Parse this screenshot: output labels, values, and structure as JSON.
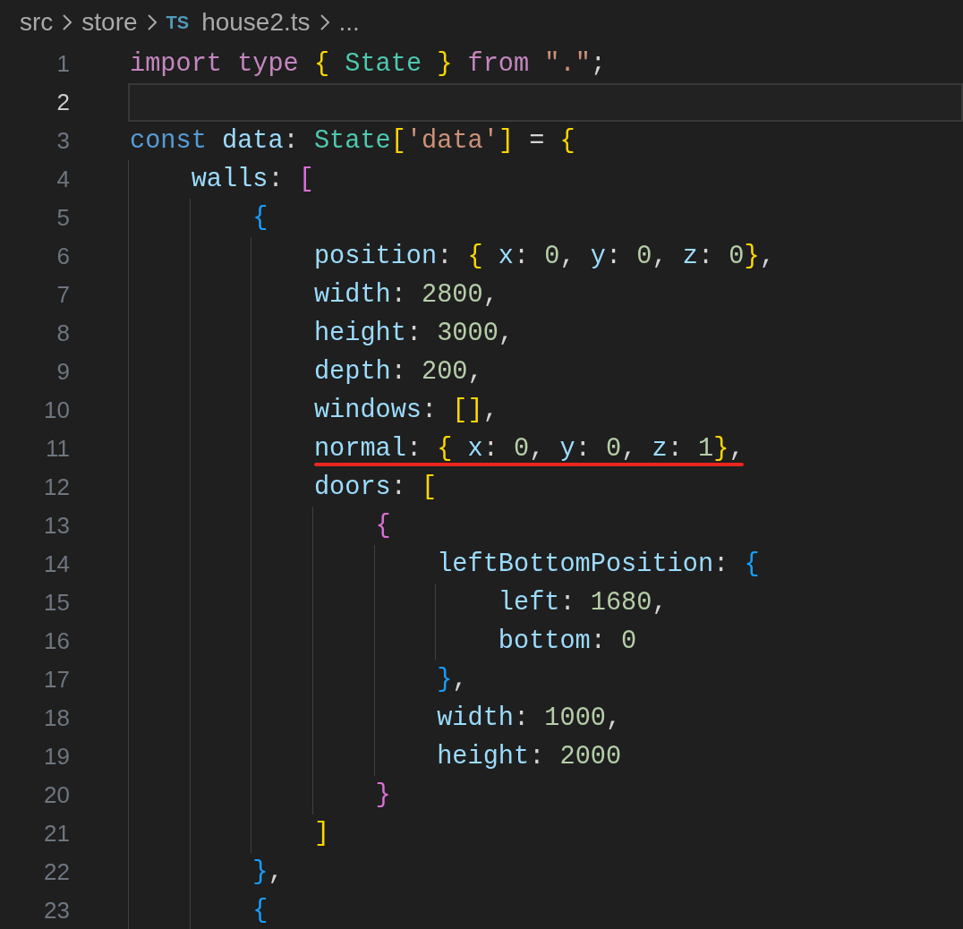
{
  "breadcrumb": [
    {
      "label": "src"
    },
    {
      "label": "store"
    },
    {
      "label": "house2.ts",
      "badge": "TS"
    },
    {
      "label": "..."
    }
  ],
  "editor": {
    "lines": [
      {
        "number": "1",
        "current": false,
        "underlined": false,
        "tokens": [
          {
            "kind": "keyword",
            "text": "import "
          },
          {
            "kind": "keyword",
            "text": "type "
          },
          {
            "kind": "bracket1",
            "text": "{ "
          },
          {
            "kind": "type",
            "text": "State "
          },
          {
            "kind": "bracket1",
            "text": "} "
          },
          {
            "kind": "keyword",
            "text": "from "
          },
          {
            "kind": "string",
            "text": "\".\""
          },
          {
            "kind": "punctuation",
            "text": ";"
          }
        ]
      },
      {
        "number": "2",
        "current": true
      },
      {
        "number": "3",
        "current": false,
        "underlined": false,
        "tokens": [
          {
            "kind": "storage",
            "text": "const "
          },
          {
            "kind": "variable",
            "text": "data"
          },
          {
            "kind": "punctuation",
            "text": ": "
          },
          {
            "kind": "type",
            "text": "State"
          },
          {
            "kind": "bracket1",
            "text": "["
          },
          {
            "kind": "string",
            "text": "'data'"
          },
          {
            "kind": "bracket1",
            "text": "]"
          },
          {
            "kind": "punctuation",
            "text": " = "
          },
          {
            "kind": "bracket1",
            "text": "{"
          }
        ]
      },
      {
        "number": "4",
        "current": false,
        "underlined": false,
        "tokens": [
          {
            "kind": "property",
            "text": "    walls"
          },
          {
            "kind": "punctuation",
            "text": ": "
          },
          {
            "kind": "bracket2",
            "text": "["
          }
        ]
      },
      {
        "number": "5",
        "current": false,
        "underlined": false,
        "tokens": [
          {
            "kind": "bracket3",
            "text": "        {"
          }
        ]
      },
      {
        "number": "6",
        "current": false,
        "underlined": false,
        "tokens": [
          {
            "kind": "property",
            "text": "            position"
          },
          {
            "kind": "punctuation",
            "text": ": "
          },
          {
            "kind": "bracket1",
            "text": "{ "
          },
          {
            "kind": "property",
            "text": "x"
          },
          {
            "kind": "punctuation",
            "text": ": "
          },
          {
            "kind": "number",
            "text": "0"
          },
          {
            "kind": "punctuation",
            "text": ", "
          },
          {
            "kind": "property",
            "text": "y"
          },
          {
            "kind": "punctuation",
            "text": ": "
          },
          {
            "kind": "number",
            "text": "0"
          },
          {
            "kind": "punctuation",
            "text": ", "
          },
          {
            "kind": "property",
            "text": "z"
          },
          {
            "kind": "punctuation",
            "text": ": "
          },
          {
            "kind": "number",
            "text": "0"
          },
          {
            "kind": "bracket1",
            "text": "}"
          },
          {
            "kind": "punctuation",
            "text": ","
          }
        ]
      },
      {
        "number": "7",
        "current": false,
        "underlined": false,
        "tokens": [
          {
            "kind": "property",
            "text": "            width"
          },
          {
            "kind": "punctuation",
            "text": ": "
          },
          {
            "kind": "number",
            "text": "2800"
          },
          {
            "kind": "punctuation",
            "text": ","
          }
        ]
      },
      {
        "number": "8",
        "current": false,
        "underlined": false,
        "tokens": [
          {
            "kind": "property",
            "text": "            height"
          },
          {
            "kind": "punctuation",
            "text": ": "
          },
          {
            "kind": "number",
            "text": "3000"
          },
          {
            "kind": "punctuation",
            "text": ","
          }
        ]
      },
      {
        "number": "9",
        "current": false,
        "underlined": false,
        "tokens": [
          {
            "kind": "property",
            "text": "            depth"
          },
          {
            "kind": "punctuation",
            "text": ": "
          },
          {
            "kind": "number",
            "text": "200"
          },
          {
            "kind": "punctuation",
            "text": ","
          }
        ]
      },
      {
        "number": "10",
        "current": false,
        "underlined": false,
        "tokens": [
          {
            "kind": "property",
            "text": "            windows"
          },
          {
            "kind": "punctuation",
            "text": ": "
          },
          {
            "kind": "bracket1",
            "text": "[]"
          },
          {
            "kind": "punctuation",
            "text": ","
          }
        ]
      },
      {
        "number": "11",
        "current": false,
        "underlined": true,
        "tokens": [
          {
            "kind": "property",
            "text": "            normal"
          },
          {
            "kind": "punctuation",
            "text": ": "
          },
          {
            "kind": "bracket1",
            "text": "{ "
          },
          {
            "kind": "property",
            "text": "x"
          },
          {
            "kind": "punctuation",
            "text": ": "
          },
          {
            "kind": "number",
            "text": "0"
          },
          {
            "kind": "punctuation",
            "text": ", "
          },
          {
            "kind": "property",
            "text": "y"
          },
          {
            "kind": "punctuation",
            "text": ": "
          },
          {
            "kind": "number",
            "text": "0"
          },
          {
            "kind": "punctuation",
            "text": ", "
          },
          {
            "kind": "property",
            "text": "z"
          },
          {
            "kind": "punctuation",
            "text": ": "
          },
          {
            "kind": "number",
            "text": "1"
          },
          {
            "kind": "bracket1",
            "text": "}"
          },
          {
            "kind": "punctuation",
            "text": ","
          }
        ]
      },
      {
        "number": "12",
        "current": false,
        "underlined": false,
        "tokens": [
          {
            "kind": "property",
            "text": "            doors"
          },
          {
            "kind": "punctuation",
            "text": ": "
          },
          {
            "kind": "bracket1",
            "text": "["
          }
        ]
      },
      {
        "number": "13",
        "current": false,
        "underlined": false,
        "tokens": [
          {
            "kind": "bracket2",
            "text": "                {"
          }
        ]
      },
      {
        "number": "14",
        "current": false,
        "underlined": false,
        "tokens": [
          {
            "kind": "property",
            "text": "                    leftBottomPosition"
          },
          {
            "kind": "punctuation",
            "text": ": "
          },
          {
            "kind": "bracket3",
            "text": "{"
          }
        ]
      },
      {
        "number": "15",
        "current": false,
        "underlined": false,
        "tokens": [
          {
            "kind": "property",
            "text": "                        left"
          },
          {
            "kind": "punctuation",
            "text": ": "
          },
          {
            "kind": "number",
            "text": "1680"
          },
          {
            "kind": "punctuation",
            "text": ","
          }
        ]
      },
      {
        "number": "16",
        "current": false,
        "underlined": false,
        "tokens": [
          {
            "kind": "property",
            "text": "                        bottom"
          },
          {
            "kind": "punctuation",
            "text": ": "
          },
          {
            "kind": "number",
            "text": "0"
          }
        ]
      },
      {
        "number": "17",
        "current": false,
        "underlined": false,
        "tokens": [
          {
            "kind": "bracket3",
            "text": "                    }"
          },
          {
            "kind": "punctuation",
            "text": ","
          }
        ]
      },
      {
        "number": "18",
        "current": false,
        "underlined": false,
        "tokens": [
          {
            "kind": "property",
            "text": "                    width"
          },
          {
            "kind": "punctuation",
            "text": ": "
          },
          {
            "kind": "number",
            "text": "1000"
          },
          {
            "kind": "punctuation",
            "text": ","
          }
        ]
      },
      {
        "number": "19",
        "current": false,
        "underlined": false,
        "tokens": [
          {
            "kind": "property",
            "text": "                    height"
          },
          {
            "kind": "punctuation",
            "text": ": "
          },
          {
            "kind": "number",
            "text": "2000"
          }
        ]
      },
      {
        "number": "20",
        "current": false,
        "underlined": false,
        "tokens": [
          {
            "kind": "bracket2",
            "text": "                }"
          }
        ]
      },
      {
        "number": "21",
        "current": false,
        "underlined": false,
        "tokens": [
          {
            "kind": "bracket1",
            "text": "            ]"
          }
        ]
      },
      {
        "number": "22",
        "current": false,
        "underlined": false,
        "tokens": [
          {
            "kind": "bracket3",
            "text": "        }"
          },
          {
            "kind": "punctuation",
            "text": ","
          }
        ]
      },
      {
        "number": "23",
        "current": false,
        "underlined": false,
        "tokens": [
          {
            "kind": "bracket3",
            "text": "        {"
          }
        ]
      }
    ]
  }
}
